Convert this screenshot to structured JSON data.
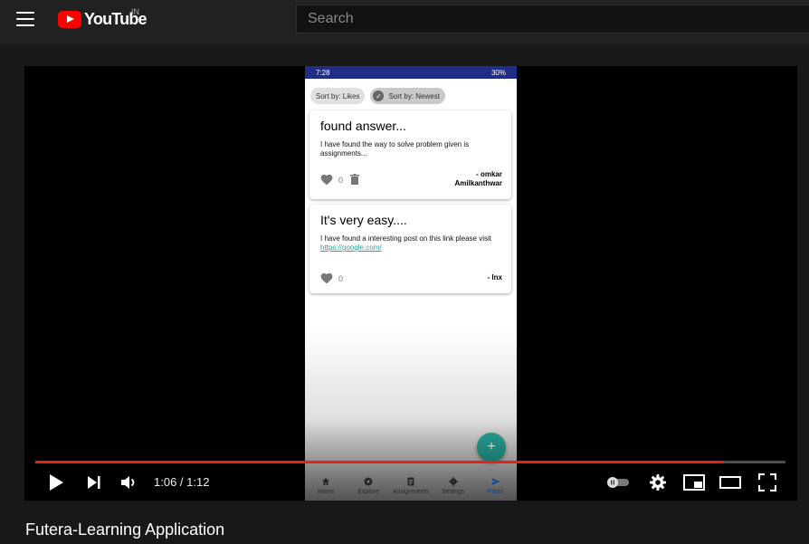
{
  "masthead": {
    "logo_text": "YouTube",
    "country_code": "IN",
    "search_placeholder": "Search"
  },
  "phone": {
    "status_time": "7:28",
    "status_battery": "30%",
    "sort_chips": [
      "Sort by: Likes",
      "Sort by: Newest"
    ],
    "active_chip": "Sort by: Newest",
    "posts": [
      {
        "title": "found answer...",
        "body": "I have found the way to solve problem given is assignments...",
        "link": "",
        "likes": "0",
        "author_line1": "- omkar",
        "author_line2": "Amilkanthwar",
        "deletable": true
      },
      {
        "title": "It's very easy....",
        "body": "I have found a interesting post on this link please visit",
        "link": "https://google.com/",
        "likes": "0",
        "author_line1": "- lnx",
        "author_line2": "",
        "deletable": false
      }
    ],
    "fab_label": "+",
    "nav": [
      "Home",
      "Explore",
      "Assignments",
      "Settings",
      "Posts"
    ],
    "active_nav": "Posts",
    "accent_color": "#26a69a",
    "statusbar_color": "#1f2d87"
  },
  "player": {
    "time_display": "1:06 / 1:12",
    "progress_fraction": 0.917,
    "progress_color": "#e62117"
  },
  "video": {
    "title": "Futera-Learning Application"
  }
}
